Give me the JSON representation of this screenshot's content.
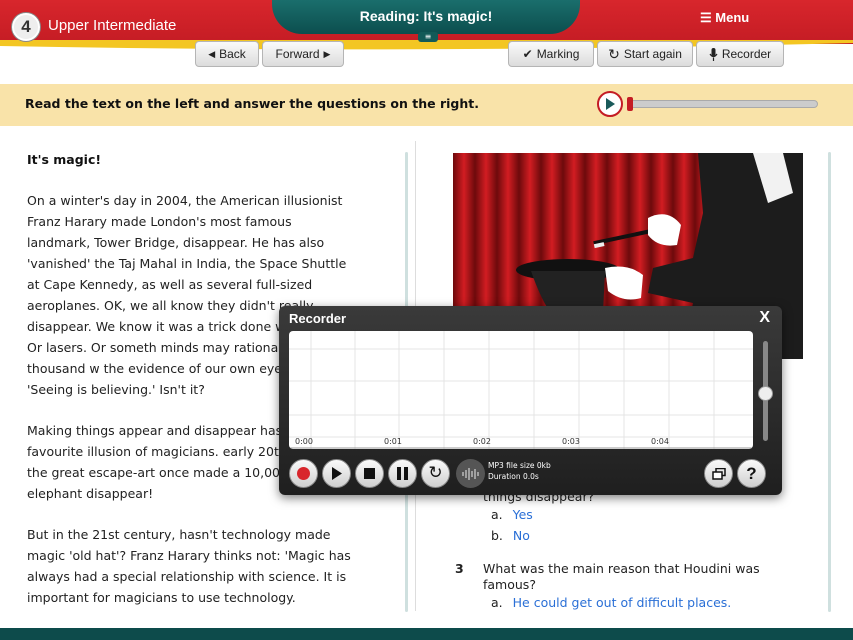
{
  "header": {
    "level_number": "4",
    "level_name": "Upper Intermediate",
    "title": "Reading: It's magic!",
    "menu_label": "Menu",
    "back_label": "Back",
    "forward_label": "Forward",
    "marking_label": "Marking",
    "start_again_label": "Start again",
    "recorder_label": "Recorder"
  },
  "instruction": "Read the text on the left and answer the questions on the right.",
  "article": {
    "title": "It's magic!",
    "paragraphs": [
      "On a winter's day in 2004, the American illusionist Franz Harary made London's most famous landmark, Tower Bridge, disappear. He has also 'vanished' the Taj Mahal in India, the Space Shuttle at Cape Kennedy, as well as several full-sized aeroplanes. OK, we all know they didn't really disappear. We know it was a trick done with mirrors. Or lasers. Or someth minds may rationalise it in a thousand w the evidence of our own eyes says othe 'Seeing is believing.' Isn't it?",
      "Making things appear and disappear has been the favourite illusion of magicians. early 20th century, the great escape-art once made a 10,000-pound elephant disappear!",
      "But in the 21st century, hasn't technology made magic 'old hat'? Franz Harary thinks not: 'Magic has always had a special relationship with science. It is important for magicians to use technology."
    ]
  },
  "questions": {
    "q2_partial": "things disappear?",
    "q2_answers": [
      {
        "letter": "a.",
        "text": "Yes"
      },
      {
        "letter": "b.",
        "text": "No"
      }
    ],
    "q3_number": "3",
    "q3_text": "What was the main reason that Houdini was famous?",
    "q3_answers": [
      {
        "letter": "a.",
        "text": "He could get out of difficult places."
      }
    ],
    "overflow_s": "s"
  },
  "recorder": {
    "title": "Recorder",
    "close": "X",
    "time_ticks": [
      "0:00",
      "0:01",
      "0:02",
      "0:03",
      "0:04"
    ],
    "file_size": "MP3 file size 0kb",
    "duration": "Duration 0.0s"
  },
  "colors": {
    "brand_red": "#c41c24",
    "brand_teal": "#0d4b4b",
    "instruction_bg": "#f9e3a9",
    "answer_blue": "#2a6fd6"
  }
}
